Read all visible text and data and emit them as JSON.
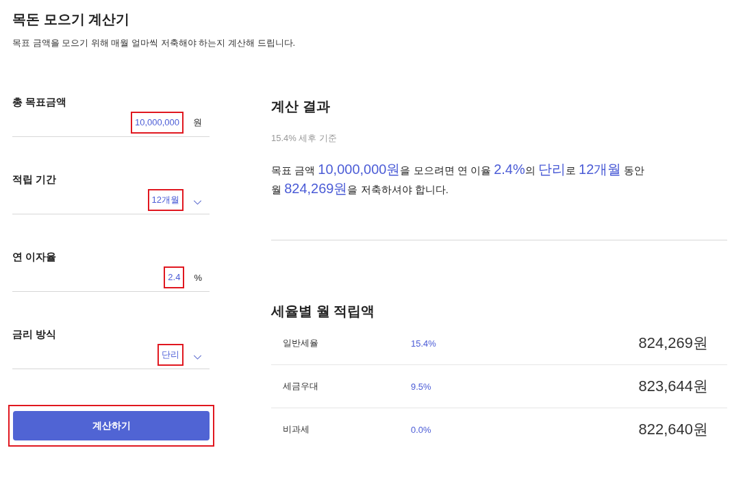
{
  "page": {
    "title": "목돈 모으기 계산기",
    "subtitle": "목표 금액을 모으기 위해 매월 얼마씩 저축해야 하는지 계산해 드립니다."
  },
  "form": {
    "fields": [
      {
        "label": "총 목표금액",
        "kind": "input",
        "value": "10,000,000",
        "unit": "원",
        "highlighted": true
      },
      {
        "label": "적립 기간",
        "kind": "select",
        "value": "12개월",
        "highlighted": true
      },
      {
        "label": "연 이자율",
        "kind": "input",
        "value": "2.4",
        "unit": "%",
        "highlighted": true
      },
      {
        "label": "금리 방식",
        "kind": "select",
        "value": "단리",
        "highlighted": true
      }
    ],
    "submit": {
      "label": "계산하기",
      "highlighted": true
    }
  },
  "result": {
    "title": "계산 결과",
    "basis": "15.4% 세후 기준",
    "summary": "목표 금액 **10,000,000원**을 모으려면 연 이율 **2.4%**의 **단리**로 **12개월** 동안 월 **824,269원**을 저축하셔야 합니다."
  },
  "breakdown": {
    "title": "세율별 월 적립액",
    "rows": [
      {
        "name": "일반세율",
        "rate": "15.4%",
        "amount": "824,269원"
      },
      {
        "name": "세금우대",
        "rate": "9.5%",
        "amount": "823,644원"
      },
      {
        "name": "비과세",
        "rate": "0.0%",
        "amount": "822,640원"
      }
    ]
  }
}
